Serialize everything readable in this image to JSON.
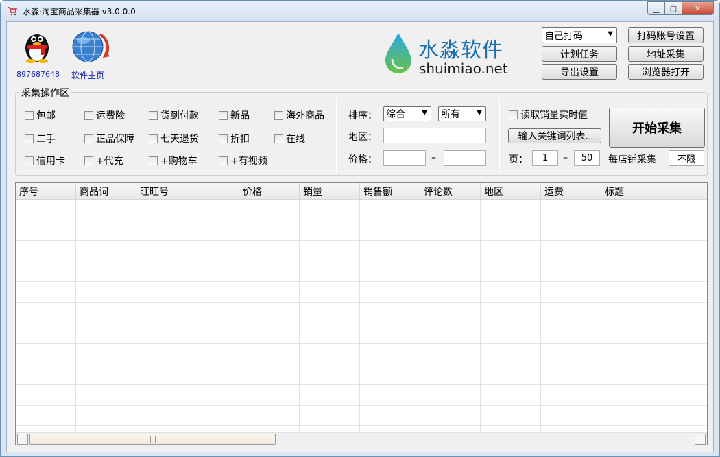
{
  "window": {
    "title": "水淼·淘宝商品采集器 v3.0.0.0",
    "min_symbol": "▁",
    "max_symbol": "▢",
    "close_symbol": "✕"
  },
  "header": {
    "qq_label": "897687648",
    "home_label": "软件主页",
    "logo_cn": "水淼软件",
    "logo_en": "shuimiao.net"
  },
  "top_buttons": {
    "captcha_select": "自己打码",
    "captcha_account": "打码账号设置",
    "schedule": "计划任务",
    "address_collect": "地址采集",
    "export_settings": "导出设置",
    "browser_open": "浏览器打开"
  },
  "op_area": {
    "title": "采集操作区",
    "checkboxes": [
      "包邮",
      "运费险",
      "货到付款",
      "新品",
      "海外商品",
      "二手",
      "正品保障",
      "七天退货",
      "折扣",
      "在线",
      "信用卡",
      "+代充",
      "+购物车",
      "+有视频"
    ],
    "sort_label": "排序：",
    "sort_value": "综合",
    "sort_filter_value": "所有",
    "region_label": "地区：",
    "region_value": "",
    "price_label": "价格：",
    "price_min": "",
    "price_sep": "–",
    "price_max": "",
    "realtime_sales_label": "读取销量实时值",
    "keywords_button": "输入关键词列表..",
    "page_label": "页：",
    "page_from": "1",
    "page_sep": "–",
    "page_to": "50",
    "per_shop_label": "每店铺采集",
    "per_shop_value": "不限",
    "start_button": "开始采集"
  },
  "table": {
    "columns": [
      "序号",
      "商品词",
      "旺旺号",
      "价格",
      "销量",
      "销售额",
      "评论数",
      "地区",
      "运费",
      "标题"
    ],
    "rows": []
  },
  "colors": {
    "link_blue": "#1a2bb0",
    "logo_blue": "#1e6fb0",
    "logo_drop_top": "#2aa7e0",
    "logo_drop_bottom": "#6cc04a"
  }
}
